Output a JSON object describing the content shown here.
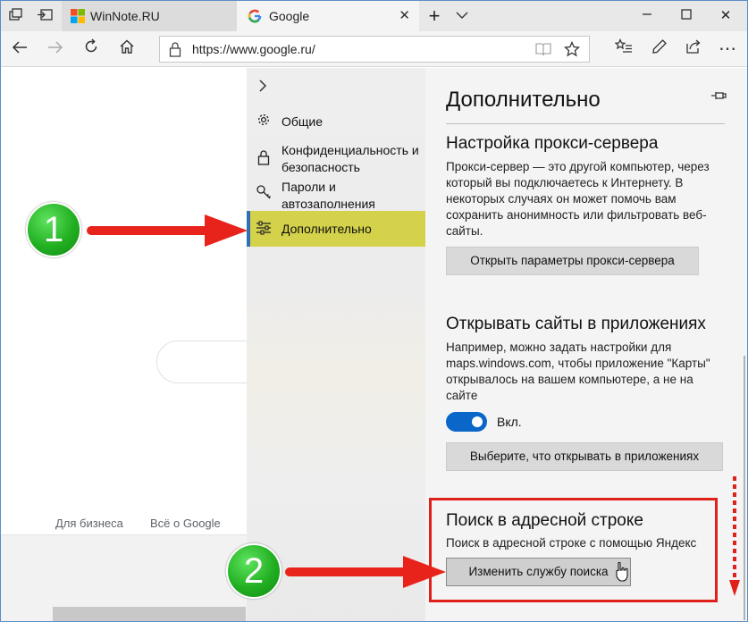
{
  "browser": {
    "tabs": [
      {
        "title": "WinNote.RU",
        "active": false
      },
      {
        "title": "Google",
        "active": true
      }
    ],
    "address": {
      "url": "https://www.google.ru/"
    },
    "window_controls": [
      "minimize",
      "maximize",
      "close"
    ]
  },
  "page": {
    "footer_links": [
      "Для бизнеса",
      "Всё о Google"
    ]
  },
  "settings_nav": {
    "items": [
      {
        "label": "Общие",
        "icon": "gear-icon",
        "selected": false
      },
      {
        "label": "Конфиденциальность и безопасность",
        "icon": "lock-icon",
        "selected": false
      },
      {
        "label": "Пароли и автозаполнения",
        "icon": "key-icon",
        "selected": false
      },
      {
        "label": "Дополнительно",
        "icon": "sliders-icon",
        "selected": true
      }
    ]
  },
  "settings": {
    "title": "Дополнительно",
    "proxy": {
      "title": "Настройка прокси-сервера",
      "text": "Прокси-сервер — это другой компьютер, через который вы подключаетесь к Интернету. В некоторых случаях он может помочь вам сохранить анонимность или фильтровать веб-сайты.",
      "button": "Открыть параметры прокси-сервера"
    },
    "apps": {
      "title": "Открывать сайты в приложениях",
      "text": "Например, можно задать настройки для maps.windows.com, чтобы приложение \"Карты\" открывалось на  вашем компьютере, а не на сайте",
      "toggle_label": "Вкл.",
      "toggle_on": true,
      "button": "Выберите, что открывать в приложениях"
    },
    "search": {
      "title": "Поиск в адресной строке",
      "text": "Поиск в адресной строке с помощью Яндекс",
      "button": "Изменить службу поиска"
    }
  },
  "annotations": {
    "step1": "1",
    "step2": "2"
  },
  "colors": {
    "accent_selected": "#d4d14a",
    "toggle": "#0a66c8",
    "highlight": "#e0201a",
    "badge": "#22b022"
  }
}
